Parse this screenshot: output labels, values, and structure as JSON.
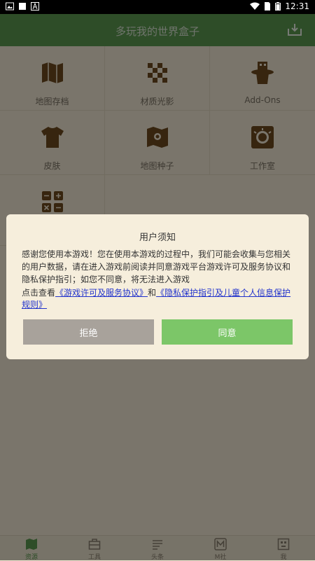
{
  "status_bar": {
    "time": "12:31"
  },
  "app_bar": {
    "title": "多玩我的世界盒子"
  },
  "grid": {
    "items": [
      {
        "label": "地图存档",
        "icon": "map-icon"
      },
      {
        "label": "材质光影",
        "icon": "checker-icon"
      },
      {
        "label": "Add-Ons",
        "icon": "magic-hat-icon"
      },
      {
        "label": "皮肤",
        "icon": "shirt-icon"
      },
      {
        "label": "地图种子",
        "icon": "map-seed-icon"
      },
      {
        "label": "工作室",
        "icon": "studio-badge-icon"
      },
      {
        "label": "",
        "icon": "calculator-icon"
      }
    ]
  },
  "dialog": {
    "title": "用户须知",
    "body": "感谢您使用本游戏！您在使用本游戏的过程中，我们可能会收集与您相关的用户数据，请在进入游戏前阅读并同意游戏平台游戏许可及服务协议和隐私保护指引；如您不同意，将无法进入游戏",
    "links_prefix": "点击查看",
    "link_license": "《游戏许可及服务协议》",
    "links_and": "和",
    "link_privacy": "《隐私保护指引及儿童个人信息保护规则》",
    "reject_label": "拒绝",
    "agree_label": "同意"
  },
  "bottom_nav": {
    "items": [
      {
        "label": "资源",
        "icon": "map-icon",
        "active": true
      },
      {
        "label": "工具",
        "icon": "toolbox-icon"
      },
      {
        "label": "头条",
        "icon": "news-icon"
      },
      {
        "label": "M社",
        "icon": "m-community-icon"
      },
      {
        "label": "我",
        "icon": "profile-icon"
      }
    ]
  },
  "colors": {
    "appbar": "#5c9a50",
    "background": "#f4ebd6",
    "icon_brown": "#6e4a1e",
    "agree_button": "#7cc668",
    "reject_button": "#a8a29b",
    "link": "#2233cc"
  }
}
